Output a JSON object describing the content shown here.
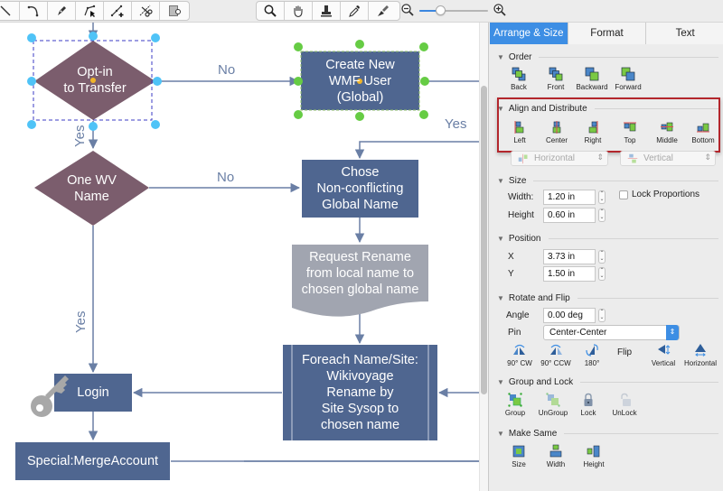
{
  "toolbar": {
    "drawing_tools": [
      {
        "icon": "line-icon",
        "label": "Line"
      },
      {
        "icon": "arc-icon",
        "label": "Arc"
      },
      {
        "icon": "pen-icon",
        "label": "Pen"
      },
      {
        "icon": "direct-select-icon",
        "label": "Direct Selection"
      },
      {
        "icon": "add-point-icon",
        "label": "Add Point"
      },
      {
        "icon": "scissors-icon",
        "label": "Cut Path"
      },
      {
        "icon": "container-icon",
        "label": "Container"
      }
    ],
    "view_tools": [
      {
        "icon": "magnifier-icon",
        "label": "Zoom"
      },
      {
        "icon": "hand-icon",
        "label": "Pan"
      },
      {
        "icon": "stamp-icon",
        "label": "Stamp"
      },
      {
        "icon": "eyedropper-icon",
        "label": "Eyedropper"
      },
      {
        "icon": "brush-icon",
        "label": "Format Painter"
      }
    ],
    "zoom_level": 0.3
  },
  "diagram": {
    "nodes": {
      "opt_in": "Opt-in\nto Transfer",
      "create_user": "Create New\nWMF User\n(Global)",
      "one_wv_name": "One WV\nName",
      "chose_name": "Chose\nNon-conflicting\nGlobal Name",
      "request_rename": "Request Rename\nfrom local name to\nchosen global name",
      "foreach": "Foreach Name/Site:\nWikivoyage\nRename by\nSite Sysop to\nchosen name",
      "login": "Login",
      "merge_account": "Special:MergeAccount"
    },
    "edge_labels": {
      "opt_in_no": "No",
      "opt_in_yes": "Yes",
      "create_yes": "Yes",
      "one_wv_no": "No",
      "one_wv_yes": "Yes"
    },
    "colors": {
      "decision": "#7b5d6d",
      "process": "#4f6690",
      "document": "#a1a5b0",
      "connector": "#6a7fa5",
      "selection_blue": "#4fc3f7",
      "selection_green": "#66cc44"
    }
  },
  "panel": {
    "tabs": [
      {
        "label": "Arrange & Size",
        "active": true
      },
      {
        "label": "Format",
        "active": false
      },
      {
        "label": "Text",
        "active": false
      }
    ],
    "order": {
      "title": "Order",
      "buttons": [
        "Back",
        "Front",
        "Backward",
        "Forward"
      ]
    },
    "align": {
      "title": "Align and Distribute",
      "buttons": [
        "Left",
        "Center",
        "Right",
        "Top",
        "Middle",
        "Bottom"
      ],
      "horizontal": "Horizontal",
      "vertical": "Vertical"
    },
    "size": {
      "title": "Size",
      "width_label": "Width:",
      "width_value": "1.20 in",
      "height_label": "Height",
      "height_value": "0.60 in",
      "lock_label": "Lock Proportions",
      "lock_checked": false
    },
    "position": {
      "title": "Position",
      "x_label": "X",
      "x_value": "3.73 in",
      "y_label": "Y",
      "y_value": "1.50 in"
    },
    "rotate": {
      "title": "Rotate and Flip",
      "angle_label": "Angle",
      "angle_value": "0.00 deg",
      "pin_label": "Pin",
      "pin_value": "Center-Center",
      "buttons": [
        "90° CW",
        "90° CCW",
        "180°"
      ],
      "flip_label": "Flip",
      "flip_buttons": [
        "Vertical",
        "Horizontal"
      ]
    },
    "group": {
      "title": "Group and Lock",
      "buttons": [
        "Group",
        "UnGroup",
        "Lock",
        "UnLock"
      ]
    },
    "make_same": {
      "title": "Make Same",
      "buttons": [
        "Size",
        "Width",
        "Height"
      ]
    },
    "highlight_color": "#b3262c"
  }
}
